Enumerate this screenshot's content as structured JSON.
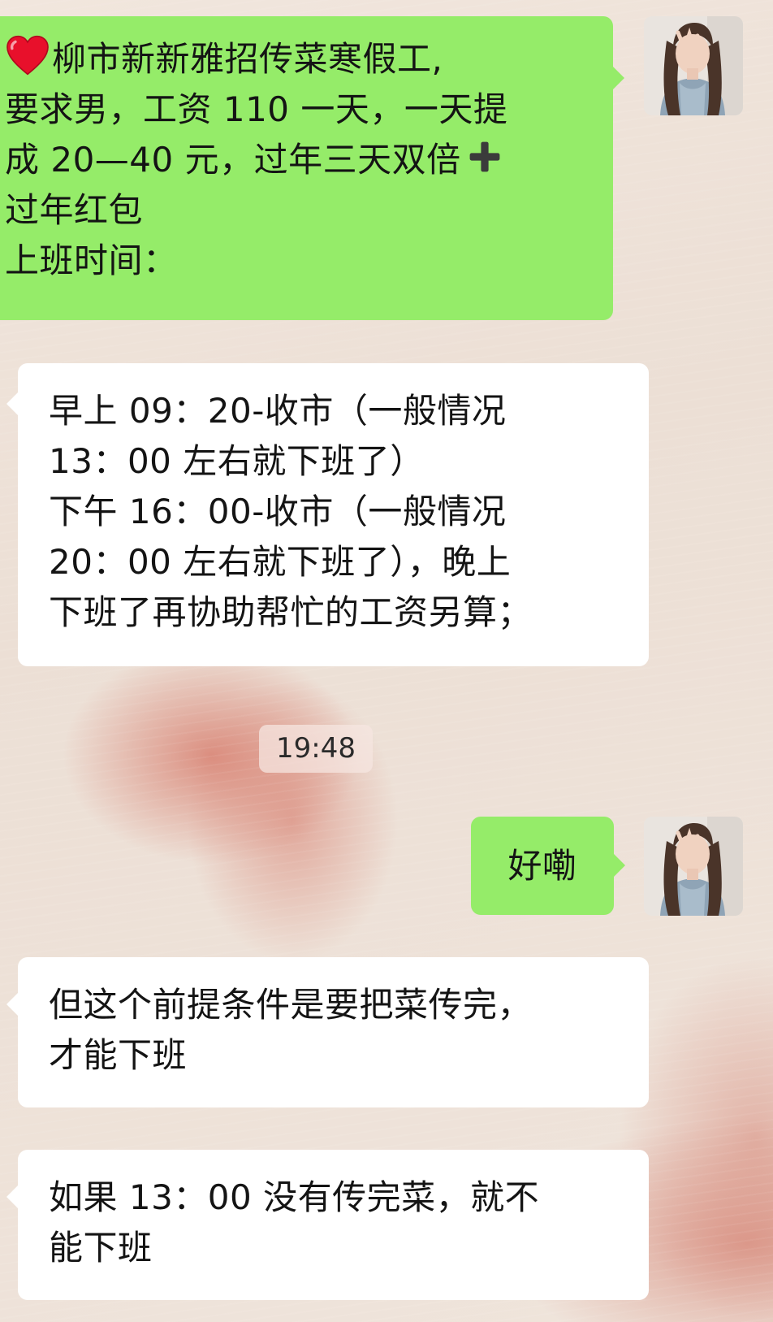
{
  "chat": {
    "messages": [
      {
        "sender": "me",
        "lines": [
          "柳市新新雅招传菜寒假工,",
          "要求男，工资 110 一天，一天提",
          "成 20—40 元，过年三天双倍",
          "过年红包",
          "上班时间："
        ],
        "emojis": [
          "heart-emoji",
          "heavy-plus-emoji"
        ]
      },
      {
        "sender": "other",
        "lines": [
          "早上 09：20-收市（一般情况",
          "13：00 左右就下班了）",
          "下午 16：00-收市（一般情况",
          "20：00 左右就下班了），晚上",
          "下班了再协助帮忙的工资另算；"
        ]
      },
      {
        "sender": "me",
        "lines": [
          "好嘞"
        ]
      },
      {
        "sender": "other",
        "lines": [
          "但这个前提条件是要把菜传完，",
          "才能下班"
        ]
      },
      {
        "sender": "other",
        "lines": [
          "如果 13：00 没有传完菜，就不",
          "能下班"
        ]
      }
    ],
    "timestamp": "19:48"
  },
  "colors": {
    "my_bubble": "#95ec69",
    "their_bubble": "#ffffff",
    "background": "#efe3da",
    "accent_pink": "#d67868"
  }
}
